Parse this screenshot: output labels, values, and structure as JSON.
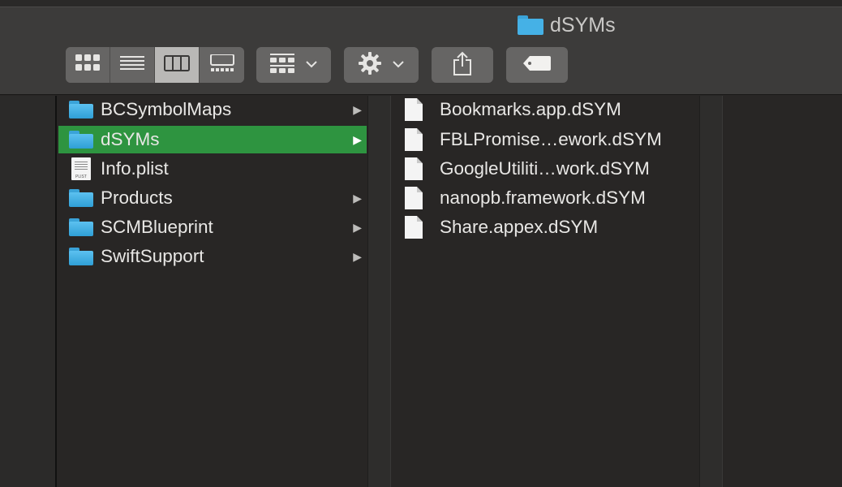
{
  "window": {
    "title": "dSYMs"
  },
  "toolbar": {
    "view_modes": [
      {
        "name": "icon-view",
        "icon": "grid-icon",
        "active": false
      },
      {
        "name": "list-view",
        "icon": "list-icon",
        "active": false
      },
      {
        "name": "column-view",
        "icon": "columns-icon",
        "active": true
      },
      {
        "name": "gallery-view",
        "icon": "gallery-icon",
        "active": false
      }
    ],
    "group_icon": "group-by-icon",
    "action_icon": "gear-icon",
    "share_icon": "share-icon",
    "tag_icon": "tag-icon"
  },
  "column1": {
    "items": [
      {
        "label": "BCSymbolMaps",
        "kind": "folder",
        "has_children": true,
        "selected": false
      },
      {
        "label": "dSYMs",
        "kind": "folder",
        "has_children": true,
        "selected": true
      },
      {
        "label": "Info.plist",
        "kind": "plist",
        "has_children": false,
        "selected": false,
        "badge": "PLIST"
      },
      {
        "label": "Products",
        "kind": "folder",
        "has_children": true,
        "selected": false
      },
      {
        "label": "SCMBlueprint",
        "kind": "folder",
        "has_children": true,
        "selected": false
      },
      {
        "label": "SwiftSupport",
        "kind": "folder",
        "has_children": true,
        "selected": false
      }
    ]
  },
  "column2": {
    "items": [
      {
        "label": "Bookmarks.app.dSYM",
        "kind": "document"
      },
      {
        "label": "FBLPromise…ework.dSYM",
        "kind": "document"
      },
      {
        "label": "GoogleUtiliti…work.dSYM",
        "kind": "document"
      },
      {
        "label": "nanopb.framework.dSYM",
        "kind": "document"
      },
      {
        "label": "Share.appex.dSYM",
        "kind": "document"
      }
    ]
  },
  "colors": {
    "selection": "#2e9440",
    "folder": "#3aa3d8",
    "text": "#e8e7e5"
  }
}
